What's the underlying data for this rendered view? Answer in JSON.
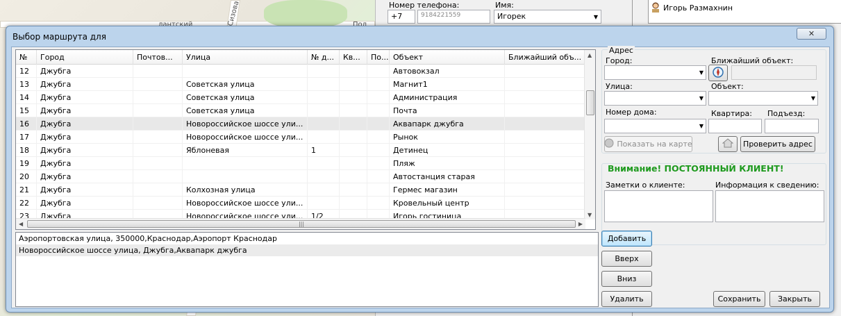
{
  "background": {
    "map_labels": [
      "лантский",
      "Сизова",
      "Пол"
    ],
    "phone_label": "Номер телефона:",
    "phone_prefix": "+7",
    "phone_number": "9184221559",
    "name_label": "Имя:",
    "name_value": "Игорек",
    "user_name": "Игорь Размахнин"
  },
  "dialog": {
    "title": "Выбор маршрута для",
    "close_label": "✕"
  },
  "grid": {
    "columns": [
      "№",
      "Город",
      "Почтов...",
      "Улица",
      "№ д...",
      "Кв...",
      "По...",
      "Объект",
      "Ближайший объ..."
    ],
    "rows": [
      [
        "12",
        "Джубга",
        "",
        "",
        "",
        "",
        "",
        "Автовокзал",
        ""
      ],
      [
        "13",
        "Джубга",
        "",
        "Советская улица",
        "",
        "",
        "",
        "Магнит1",
        ""
      ],
      [
        "14",
        "Джубга",
        "",
        "Советская улица",
        "",
        "",
        "",
        "Администрация",
        ""
      ],
      [
        "15",
        "Джубга",
        "",
        "Советская улица",
        "",
        "",
        "",
        "Почта",
        ""
      ],
      [
        "16",
        "Джубга",
        "",
        "Новороссийское шоссе ули...",
        "",
        "",
        "",
        "Аквапарк джубга",
        ""
      ],
      [
        "17",
        "Джубга",
        "",
        "Новороссийское шоссе ули...",
        "",
        "",
        "",
        "Рынок",
        ""
      ],
      [
        "18",
        "Джубга",
        "",
        "Яблоневая",
        "1",
        "",
        "",
        "Детинец",
        ""
      ],
      [
        "19",
        "Джубга",
        "",
        "",
        "",
        "",
        "",
        "Пляж",
        ""
      ],
      [
        "20",
        "Джубга",
        "",
        "",
        "",
        "",
        "",
        "Автостанция старая",
        ""
      ],
      [
        "21",
        "Джубга",
        "",
        "Колхозная улица",
        "",
        "",
        "",
        "Гермес магазин",
        ""
      ],
      [
        "22",
        "Джубга",
        "",
        "Новороссийское шоссе ули...",
        "",
        "",
        "",
        "Кровельный центр",
        ""
      ],
      [
        "23",
        "Джубга",
        "",
        "Новороссийское шоссе ули...",
        "1/2",
        "",
        "",
        "Игорь гостиница",
        ""
      ]
    ],
    "selected_row": 4
  },
  "route_list": [
    "Аэропортовская улица, 350000,Краснодар,Аэропорт Краснодар",
    "Новороссийское шоссе улица, Джубга,Аквапарк джубга"
  ],
  "address": {
    "legend": "Адрес",
    "city_label": "Город:",
    "nearest_label": "Ближайший объект:",
    "street_label": "Улица:",
    "object_label": "Объект:",
    "house_label": "Номер дома:",
    "apt_label": "Квартира:",
    "entrance_label": "Подъезд:",
    "show_map_label": "Показать на карте",
    "check_label": "Проверить адрес"
  },
  "notice": {
    "text": "Внимание! ПОСТОЯННЫЙ КЛИЕНТ!",
    "notes_label": "Заметки о клиенте:",
    "info_label": "Информация к сведению:",
    "color": "#1e9a1e"
  },
  "buttons": {
    "add": "Добавить",
    "up": "Вверх",
    "down": "Вниз",
    "delete": "Удалить",
    "save": "Сохранить",
    "close": "Закрыть"
  }
}
